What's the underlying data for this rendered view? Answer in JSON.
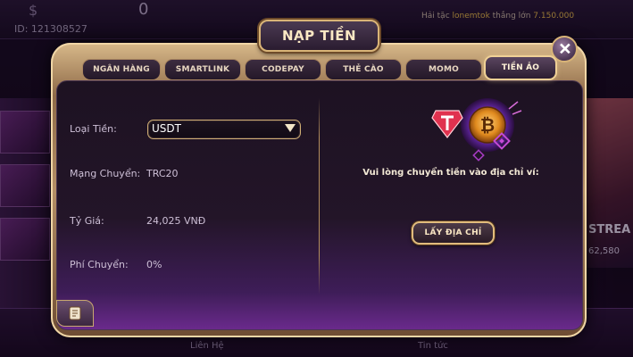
{
  "background": {
    "currency_symbol": "$",
    "balance": "0",
    "user_id": "ID: 121308527",
    "ticker": {
      "prefix": "Hải tặc",
      "player": "lonemtok",
      "suffix": "thắng lớn",
      "amount": "7.150.000"
    },
    "right_card": {
      "stream_label": "STREA",
      "amount": "62,580"
    },
    "bottom_nav": [
      "Liên Hệ",
      "Tin tức"
    ]
  },
  "modal": {
    "title": "NẠP TIỀN",
    "close_label": "+",
    "tabs": [
      {
        "label": "NGÂN HÀNG",
        "active": false
      },
      {
        "label": "SMARTLINK",
        "active": false
      },
      {
        "label": "CODEPAY",
        "active": false
      },
      {
        "label": "THẺ CÀO",
        "active": false
      },
      {
        "label": "MOMO",
        "active": false
      },
      {
        "label": "TIỀN ẢO",
        "active": true
      }
    ],
    "form": {
      "currency_label": "Loại Tiền:",
      "currency_value": "USDT",
      "network_label": "Mạng Chuyển:",
      "network_value": "TRC20",
      "rate_label": "Tỷ Giá:",
      "rate_value": "24,025 VNĐ",
      "fee_label": "Phí Chuyển:",
      "fee_value": "0%"
    },
    "right": {
      "instruction": "Vui lòng chuyển tiền vào địa chỉ ví:",
      "button_label": "LẤY ĐỊA CHỈ"
    }
  },
  "colors": {
    "frame_gold": "#d9b477",
    "panel_bg": "#1d1222",
    "accent_purple": "#6a2a8c",
    "highlight_gold": "#e3b64a"
  }
}
